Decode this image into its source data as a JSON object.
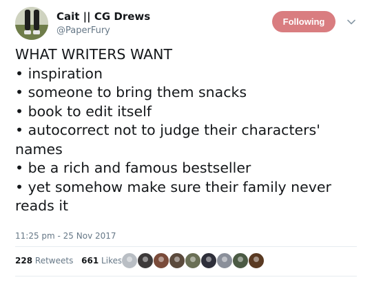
{
  "user": {
    "display_name": "Cait || CG Drews",
    "handle": "@PaperFury",
    "avatar_icon": "avatar-photo"
  },
  "follow_button": {
    "label": "Following",
    "color": "#d97d80"
  },
  "menu_icon": "chevron-down-icon",
  "tweet": {
    "lines": [
      "WHAT WRITERS WANT",
      "• inspiration",
      "• someone to bring them snacks",
      "• book to edit itself",
      "• autocorrect not to judge their characters'",
      "names",
      "• be a rich and famous bestseller",
      "• yet somehow make sure their family never",
      "reads it"
    ],
    "timestamp": "11:25 pm - 25 Nov 2017"
  },
  "stats": {
    "retweets_count": "228",
    "retweets_label": "Retweets",
    "likes_count": "661",
    "likes_label": "Likes"
  },
  "likers": [
    {
      "color": "#b9bec4"
    },
    {
      "color": "#3d3a3a"
    },
    {
      "color": "#7a4b3a"
    },
    {
      "color": "#5b4a3c"
    },
    {
      "color": "#6a6f55"
    },
    {
      "color": "#2e2f3a"
    },
    {
      "color": "#8a8f9a"
    },
    {
      "color": "#4b5a44"
    },
    {
      "color": "#5a3a22"
    }
  ]
}
